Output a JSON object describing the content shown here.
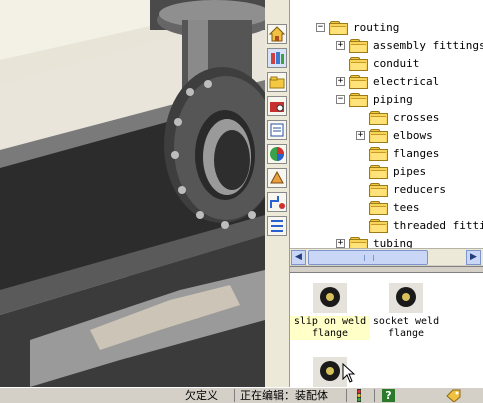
{
  "tree": {
    "items": [
      {
        "label": "routing",
        "level": 0,
        "expander": "−"
      },
      {
        "label": "assembly fittings",
        "level": 1,
        "expander": "+"
      },
      {
        "label": "conduit",
        "level": 1,
        "expander": ""
      },
      {
        "label": "electrical",
        "level": 1,
        "expander": "+"
      },
      {
        "label": "piping",
        "level": 1,
        "expander": "−"
      },
      {
        "label": "crosses",
        "level": 2,
        "expander": ""
      },
      {
        "label": "elbows",
        "level": 2,
        "expander": "+"
      },
      {
        "label": "flanges",
        "level": 2,
        "expander": ""
      },
      {
        "label": "pipes",
        "level": 2,
        "expander": ""
      },
      {
        "label": "reducers",
        "level": 2,
        "expander": ""
      },
      {
        "label": "tees",
        "level": 2,
        "expander": ""
      },
      {
        "label": "threaded fittin",
        "level": 2,
        "expander": ""
      },
      {
        "label": "tubing",
        "level": 1,
        "expander": "+"
      }
    ]
  },
  "scrollbar": {
    "left_arrow": "◀",
    "right_arrow": "▶"
  },
  "palette": {
    "parts": [
      {
        "label": "slip on weld flange",
        "selected": true
      },
      {
        "label": "socket weld flange",
        "selected": false
      },
      {
        "label": "",
        "selected": false
      }
    ]
  },
  "side_tabs": [
    "home-icon",
    "design-library-icon",
    "folder-icon",
    "toolbox-icon",
    "properties-icon",
    "appearance-icon",
    "custom-props-icon",
    "routing-icon",
    "routing-library-icon"
  ],
  "statusbar": {
    "state": "欠定义",
    "editing": "正在编辑：装配体",
    "help": "?"
  }
}
